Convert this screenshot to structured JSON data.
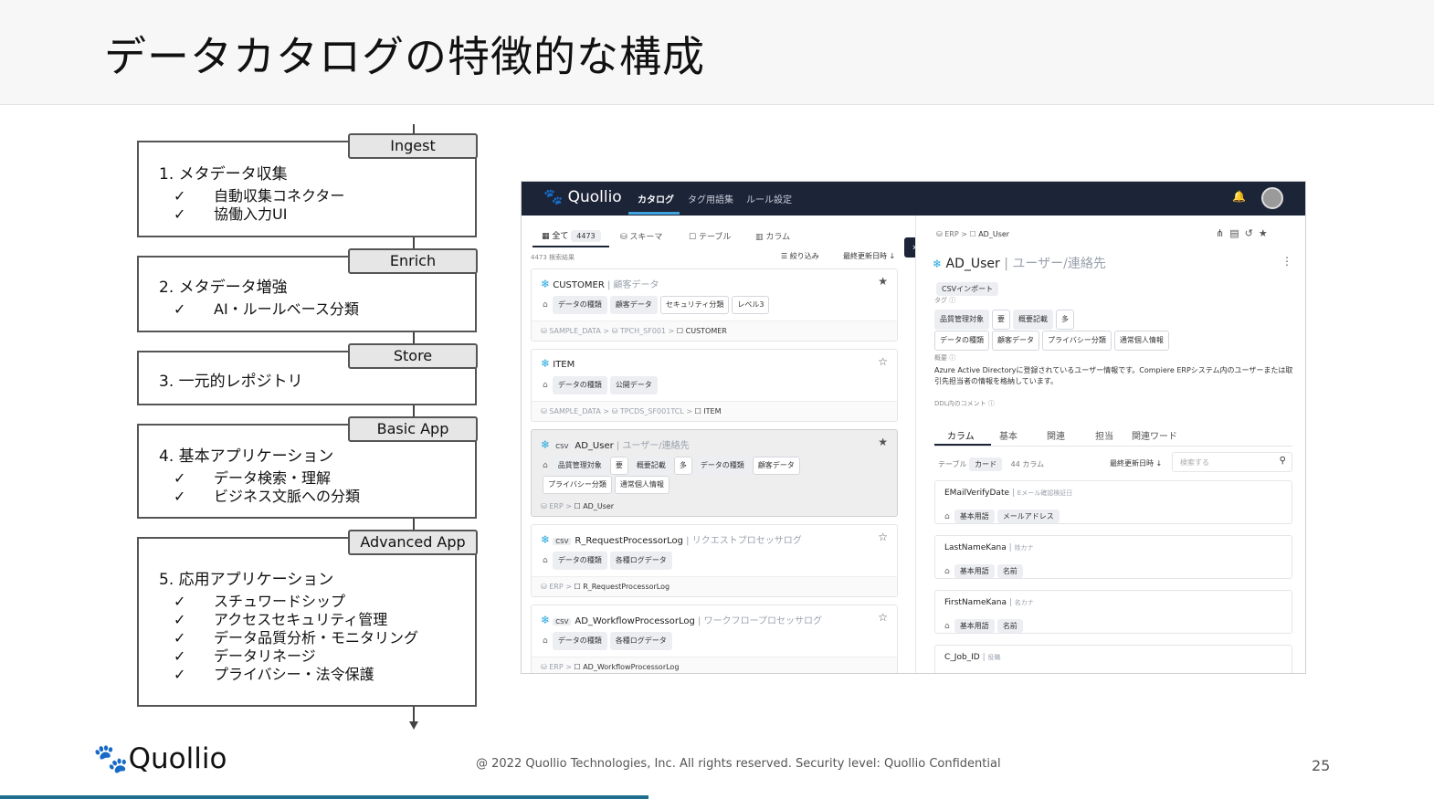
{
  "slide": {
    "title": "データカタログの特徴的な構成",
    "copyright": "@ 2022 Quollio Technologies, Inc. All rights reserved. Security level: Quollio Confidential",
    "page_number": "25",
    "footer_logo": "Quollio"
  },
  "flow": {
    "steps": [
      {
        "tab": "Ingest",
        "heading": "1. メタデータ収集",
        "bullets": [
          "自動収集コネクター",
          "協働入力UI"
        ]
      },
      {
        "tab": "Enrich",
        "heading": "2. メタデータ増強",
        "bullets": [
          "AI・ルールベース分類"
        ]
      },
      {
        "tab": "Store",
        "heading": "3. 一元的レポジトリ",
        "bullets": []
      },
      {
        "tab": "Basic App",
        "heading": "4. 基本アプリケーション",
        "bullets": [
          "データ検索・理解",
          "ビジネス文脈への分類"
        ]
      },
      {
        "tab": "Advanced App",
        "heading": "5. 応用アプリケーション",
        "bullets": [
          "スチュワードシップ",
          "アクセスセキュリティ管理",
          "データ品質分析・モニタリング",
          "データリネージ",
          "プライバシー・法令保護"
        ]
      }
    ],
    "check": "✓"
  },
  "app": {
    "logo": "Quollio",
    "nav": [
      "カタログ",
      "タグ用語集",
      "ルール設定"
    ],
    "left": {
      "tabs": [
        "全て",
        "スキーマ",
        "テーブル",
        "カラム"
      ],
      "all_count": "4473",
      "result_count": "4473 検索結果",
      "filter": "絞り込み",
      "sort": "最終更新日時",
      "cards": [
        {
          "name": "CUSTOMER",
          "alias": "顧客データ",
          "tags": [
            "データの種類",
            "顧客データ",
            "セキュリティ分類",
            "レベル3"
          ],
          "path": [
            "SAMPLE_DATA",
            "TPCH_SF001"
          ],
          "leaf": "CUSTOMER",
          "csv": false
        },
        {
          "name": "ITEM",
          "alias": "",
          "tags": [
            "データの種類",
            "公開データ"
          ],
          "path": [
            "SAMPLE_DATA",
            "TPCDS_SF001TCL"
          ],
          "leaf": "ITEM",
          "csv": false
        },
        {
          "name": "AD_User",
          "alias": "ユーザー/連絡先",
          "tags": [
            "品質管理対象",
            "要",
            "概要記載",
            "多",
            "データの種類",
            "顧客データ",
            "プライバシー分類",
            "通常個人情報"
          ],
          "path": [
            "ERP"
          ],
          "leaf": "AD_User",
          "csv": true
        },
        {
          "name": "R_RequestProcessorLog",
          "alias": "リクエストプロセッサログ",
          "tags": [
            "データの種類",
            "各種ログデータ"
          ],
          "path": [
            "ERP"
          ],
          "leaf": "R_RequestProcessorLog",
          "csv": true
        },
        {
          "name": "AD_WorkflowProcessorLog",
          "alias": "ワークフロープロセッサログ",
          "tags": [
            "データの種類",
            "各種ログデータ"
          ],
          "path": [
            "ERP"
          ],
          "leaf": "AD_WorkflowProcessorLog",
          "csv": true
        }
      ],
      "csv_label": "CSV"
    },
    "right": {
      "breadcrumb_root": "ERP",
      "breadcrumb_leaf": "AD_User",
      "title": "AD_User",
      "alias": "ユーザー/連絡先",
      "import_badge": "CSVインポート",
      "tag_label": "タグ",
      "tags": [
        "品質管理対象",
        "要",
        "概要記載",
        "多",
        "データの種類",
        "顧客データ",
        "プライバシー分類",
        "通常個人情報"
      ],
      "summary_label": "概要",
      "summary": "Azure Active Directoryに登録されているユーザー情報です。Compiere ERPシステム内のユーザーまたは取引先担当者の情報を格納しています。",
      "ddl_label": "DDL内のコメント",
      "tabs": [
        "カラム",
        "基本",
        "関連",
        "担当",
        "関連ワード"
      ],
      "table_label": "テーブル",
      "card_label": "カード",
      "column_count": "44 カラム",
      "sort": "最終更新日時",
      "search_placeholder": "検索する",
      "columns": [
        {
          "name": "EMailVerifyDate",
          "alias": "Eメール確認検証日",
          "tags": [
            "基本用語",
            "メールアドレス"
          ]
        },
        {
          "name": "LastNameKana",
          "alias": "姓カナ",
          "tags": [
            "基本用語",
            "名前"
          ]
        },
        {
          "name": "FirstNameKana",
          "alias": "名カナ",
          "tags": [
            "基本用語",
            "名前"
          ]
        },
        {
          "name": "C_Job_ID",
          "alias": "役職",
          "tags": []
        }
      ]
    }
  }
}
